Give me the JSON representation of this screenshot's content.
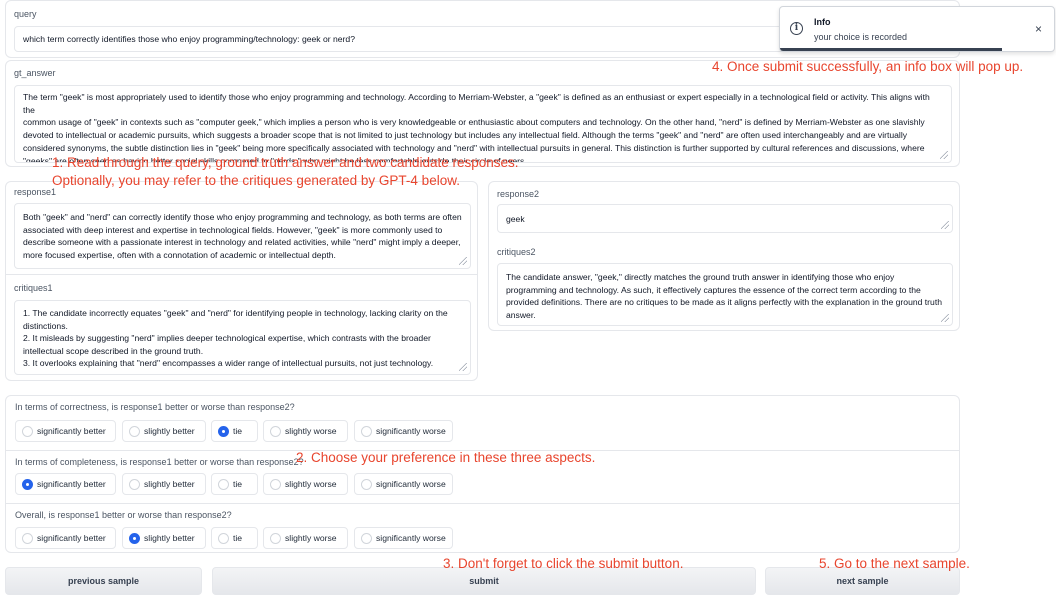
{
  "query": {
    "label": "query",
    "value": "which term correctly identifies those who enjoy programming/technology: geek or nerd?"
  },
  "gt_answer": {
    "label": "gt_answer",
    "lines": [
      "The term \"geek\" is most appropriately used to identify those who enjoy programming and technology. According to Merriam-Webster, a \"geek\" is defined as an enthusiast or expert especially in a technological field or activity. This aligns with the",
      "common usage of \"geek\" in contexts such as \"computer geek,\" which implies a person who is very knowledgeable or enthusiastic about computers and technology. On the other hand, \"nerd\" is defined by Merriam-Webster as one slavishly",
      "devoted to intellectual or academic pursuits, which suggests a broader scope that is not limited to just technology but includes any intellectual field. Although the terms \"geek\" and \"nerd\" are often used interchangeably and are virtually",
      "considered synonyms, the subtle distinction lies in \"geek\" being more specifically associated with technology and \"nerd\" with intellectual pursuits in general. This distinction is further supported by cultural references and discussions, where",
      "\"geeks\" are often seen as having better social skills compared to \"nerds,\" who might be less comfortable outside their circle of peers."
    ]
  },
  "response1": {
    "label": "response1",
    "lines": [
      "Both \"geek\" and \"nerd\" can correctly identify those who enjoy programming and technology, as both terms are often",
      "associated with deep interest and expertise in technological fields. However, \"geek\" is more commonly used to",
      "describe someone with a passionate interest in technology and related activities, while \"nerd\" might imply a deeper,",
      "more focused expertise, often with a connotation of academic or intellectual depth."
    ]
  },
  "critiques1": {
    "label": "critiques1",
    "lines": [
      "1. The candidate incorrectly equates \"geek\" and \"nerd\" for identifying people in technology, lacking clarity on the",
      "distinctions.",
      "2. It misleads by suggesting \"nerd\" implies deeper technological expertise, which contrasts with the broader",
      "intellectual scope described in the ground truth.",
      "3. It overlooks explaining that \"nerd\" encompasses a wider range of intellectual pursuits, not just technology."
    ]
  },
  "response2": {
    "label": "response2",
    "value": "geek"
  },
  "critiques2": {
    "label": "critiques2",
    "lines": [
      "The candidate answer, \"geek,\" directly matches the ground truth answer in identifying those who enjoy",
      "programming and technology. As such, it effectively captures the essence of the correct term according to the",
      "provided definitions. There are no critiques to be made as it aligns perfectly with the explanation in the ground truth",
      "answer."
    ]
  },
  "questions": [
    {
      "label": "In terms of correctness, is response1 better or worse than response2?",
      "selected": "tie"
    },
    {
      "label": "In terms of completeness, is response1 better or worse than response2?",
      "selected": "significantly better"
    },
    {
      "label": "Overall, is response1 better or worse than response2?",
      "selected": "slightly better"
    }
  ],
  "options": [
    "significantly better",
    "slightly better",
    "tie",
    "slightly worse",
    "significantly worse"
  ],
  "buttons": {
    "previous": "previous sample",
    "submit": "submit",
    "next": "next sample"
  },
  "toast": {
    "title": "Info",
    "message": "your choice is recorded",
    "close": "×"
  },
  "annotations": {
    "a1_line1": "1. Read through the query, ground truth answer and two candidate responses.",
    "a1_line2": "Optionally, you may refer to the critiques generated by GPT-4 below.",
    "a2": "2. Choose your preference in these three aspects.",
    "a3": "3. Don't forget to click the submit button.",
    "a4": "4. Once submit successfully, an info box will pop up.",
    "a5": "5. Go to the next sample."
  },
  "colors": {
    "annotation": "#e8452e",
    "radio_selected": "#2563eb"
  }
}
